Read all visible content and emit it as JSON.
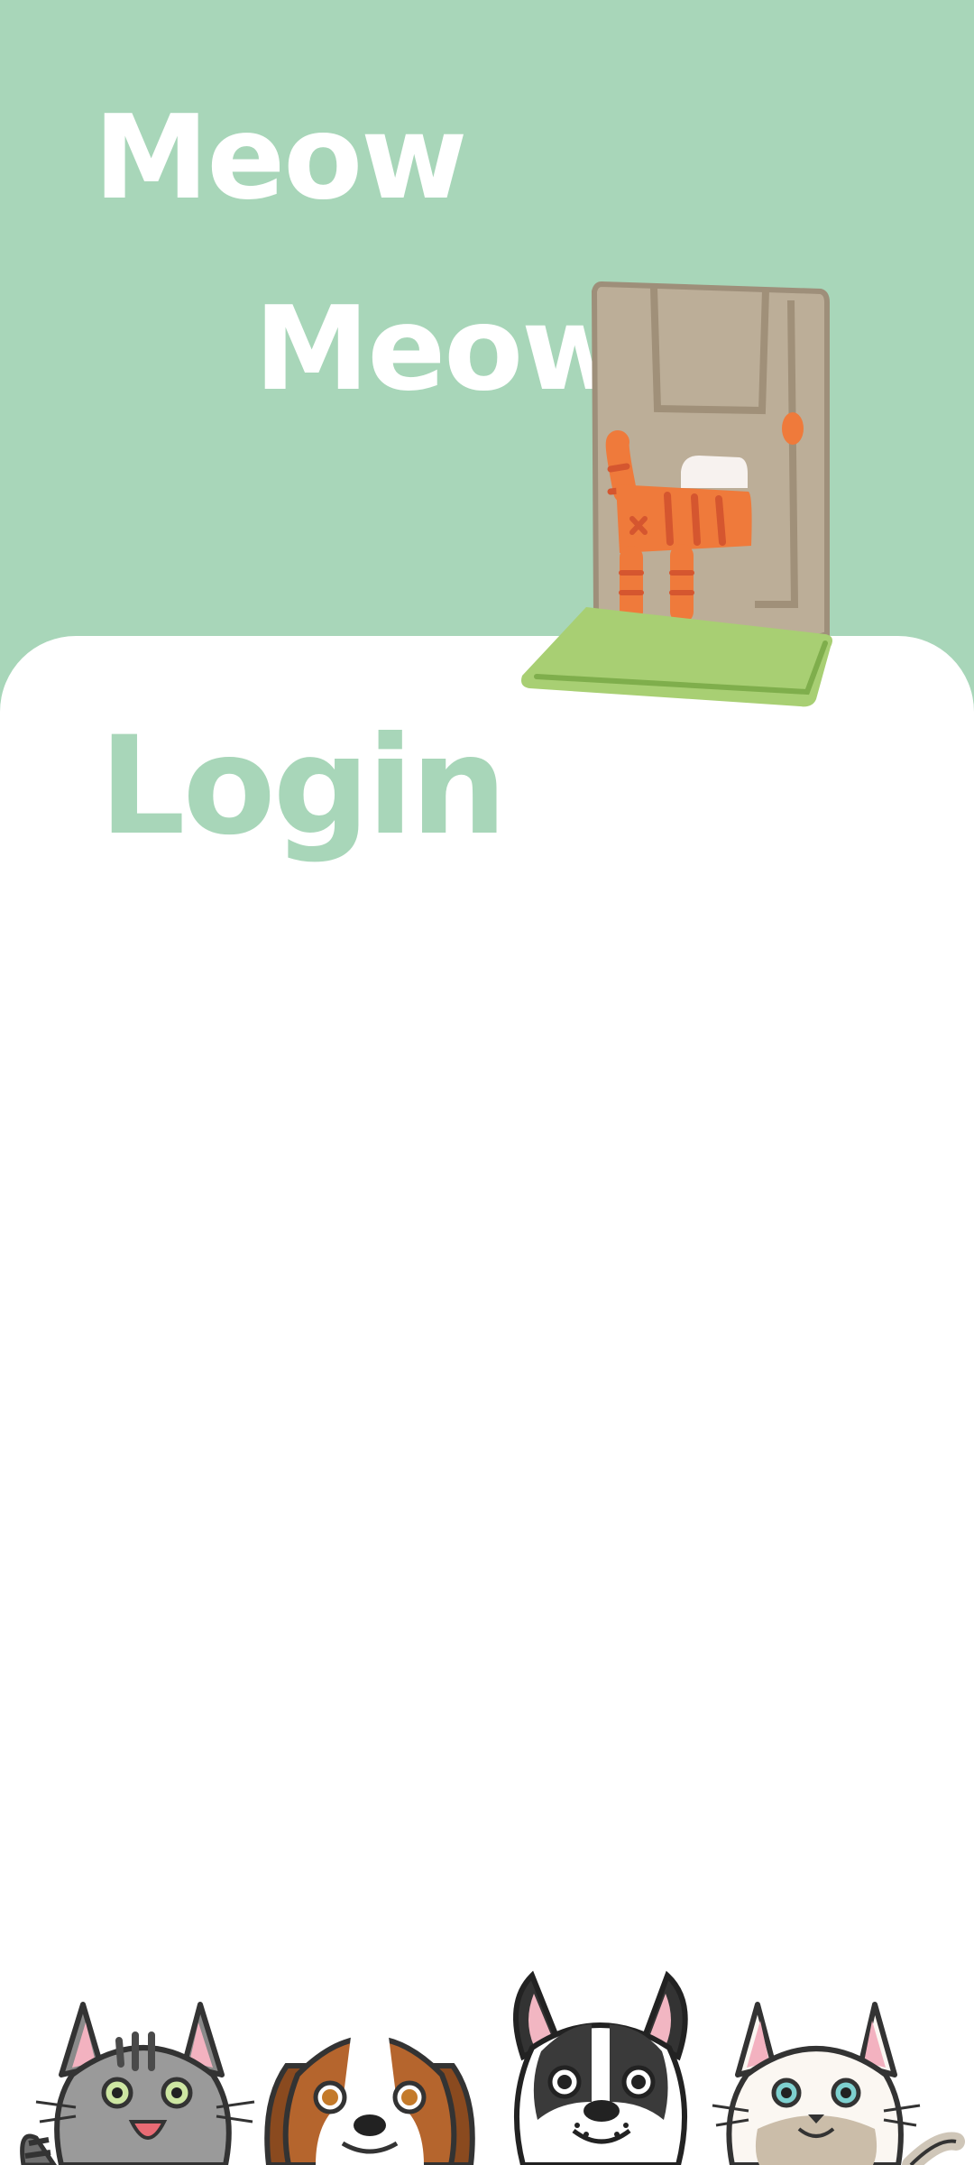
{
  "header": {
    "brand_line_1": "Meow",
    "brand_line_2": "Meow"
  },
  "login": {
    "title": "Login"
  },
  "colors": {
    "mint": "#a8d6b9",
    "card": "#ffffff",
    "door": "#bcae98",
    "mat": "#a8cf73",
    "cat_orange": "#ef7a3b"
  },
  "illustrations": {
    "door": "cat-door-illustration",
    "pets": [
      "gray-tabby-cat-icon",
      "beagle-dog-icon",
      "french-bulldog-icon",
      "white-cat-icon"
    ]
  }
}
